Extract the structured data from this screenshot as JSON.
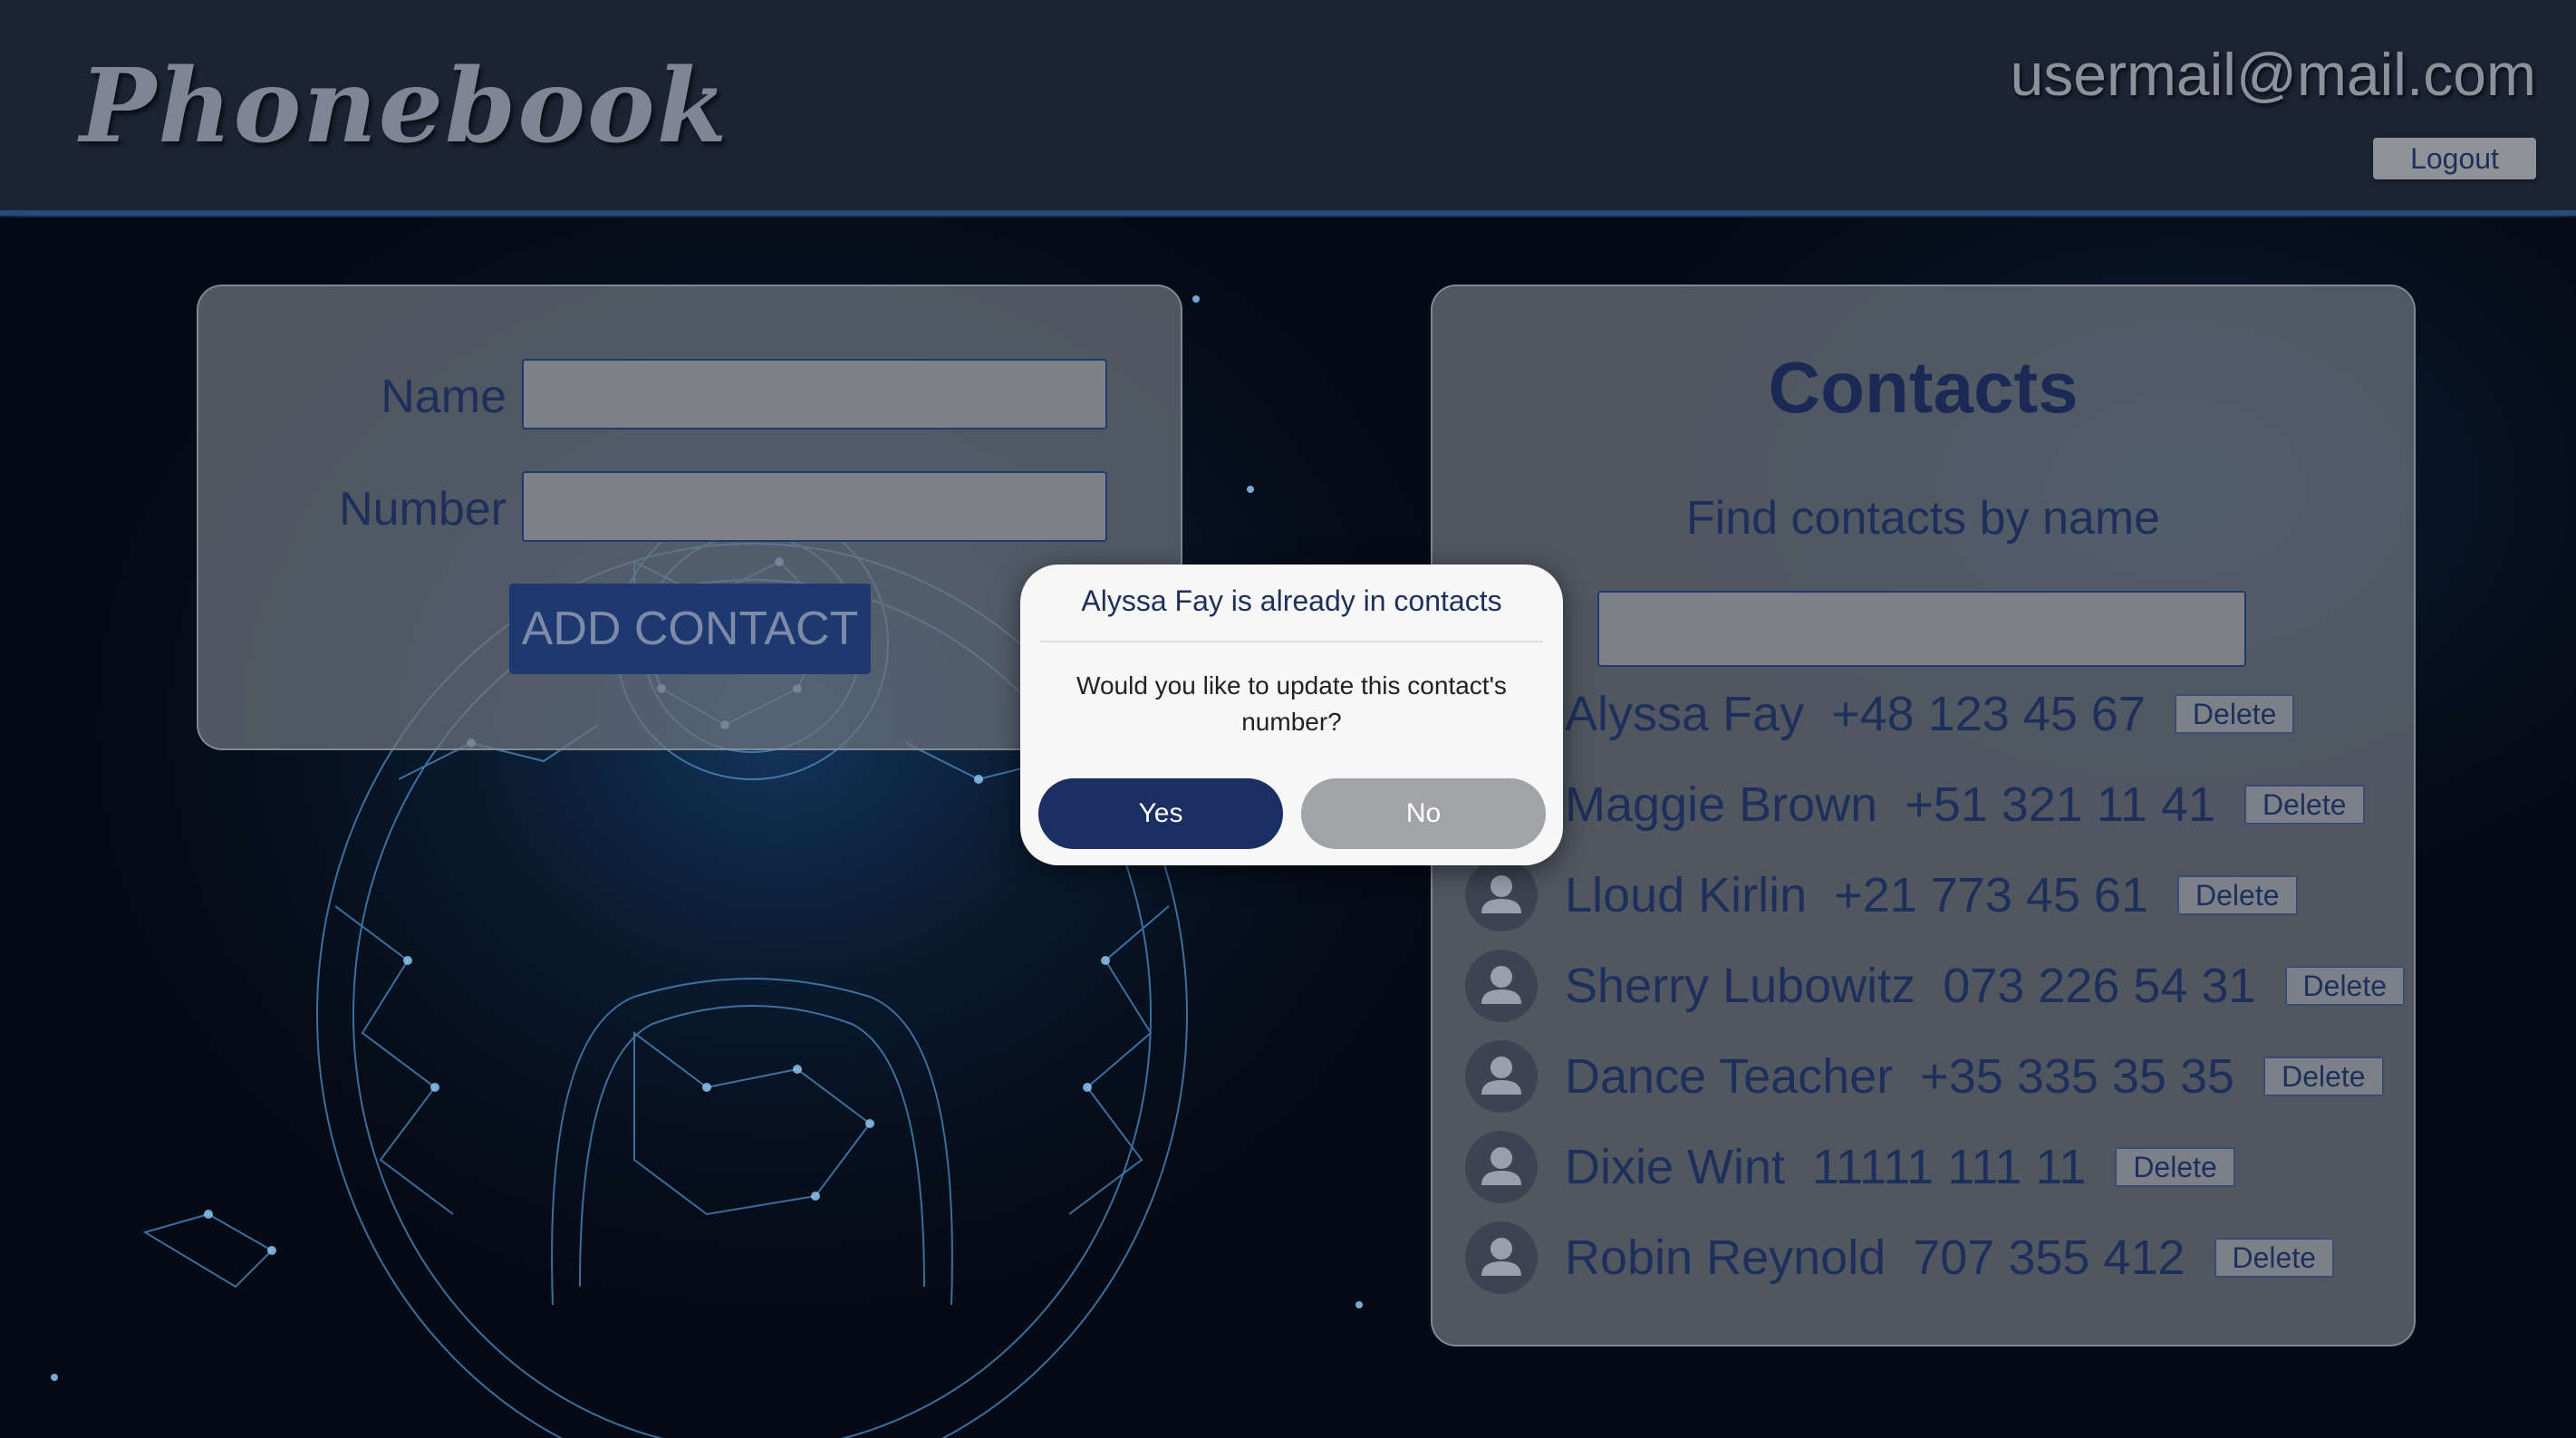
{
  "header": {
    "logo": "Phonebook",
    "user_email": "usermail@mail.com",
    "logout_label": "Logout"
  },
  "form": {
    "name_label": "Name",
    "number_label": "Number",
    "name_value": "",
    "number_value": "",
    "add_button_label": "ADD CONTACT"
  },
  "contacts": {
    "title": "Contacts",
    "filter_label": "Find contacts by name",
    "filter_value": "",
    "delete_label": "Delete",
    "items": [
      {
        "name": "Alyssa Fay",
        "number": "+48 123 45 67"
      },
      {
        "name": "Maggie Brown",
        "number": "+51 321 11 41"
      },
      {
        "name": "Lloud Kirlin",
        "number": "+21 773 45 61"
      },
      {
        "name": "Sherry Lubowitz",
        "number": "073 226 54 31"
      },
      {
        "name": "Dance Teacher",
        "number": "+35 335 35 35"
      },
      {
        "name": "Dixie Wint",
        "number": "11111 111 11"
      },
      {
        "name": "Robin Reynold",
        "number": "707 355 412"
      }
    ]
  },
  "modal": {
    "title": "Alyssa Fay is already in contacts",
    "message": "Would you like to update this contact's number?",
    "yes_label": "Yes",
    "no_label": "No"
  },
  "colors": {
    "header_bg": "#1c2333",
    "accent_dark_blue": "#1b2f62",
    "panel_gray": "#6e747e",
    "text_blue": "#1e2f5a"
  }
}
